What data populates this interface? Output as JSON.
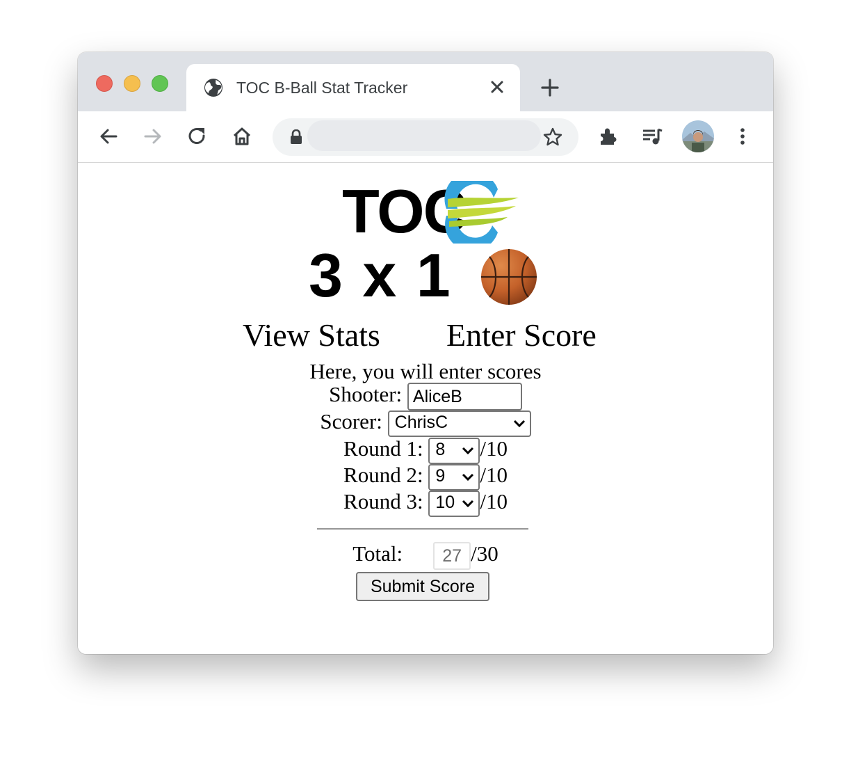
{
  "browser": {
    "tab_title": "TOC B-Ball Stat Tracker",
    "url": ""
  },
  "logo": {
    "line1": "TOC",
    "line2": "3 x 1"
  },
  "nav": {
    "view_stats": "View Stats",
    "enter_score": "Enter Score"
  },
  "form": {
    "intro": "Here, you will enter scores",
    "shooter_label": "Shooter:",
    "shooter_value": "AliceB",
    "scorer_label": "Scorer:",
    "scorer_value": "ChrisC",
    "rounds": [
      {
        "label": "Round 1:",
        "value": "8",
        "max": "/10"
      },
      {
        "label": "Round 2:",
        "value": "9",
        "max": "/10"
      },
      {
        "label": "Round 3:",
        "value": "10",
        "max": "/10"
      }
    ],
    "total_label": "Total:",
    "total_value": "27",
    "total_max": "/30",
    "submit_label": "Submit Score"
  },
  "colors": {
    "tabbar": "#dee1e6",
    "close_red": "#ee6a5f",
    "minimize_yellow": "#f5bf4f",
    "maximize_green": "#61c554",
    "logo_blue": "#35a3dc",
    "logo_green": "#b6d334",
    "ball_orange": "#c8662a"
  },
  "icons": [
    "globe-icon",
    "close-icon",
    "plus-icon",
    "back-icon",
    "forward-icon",
    "reload-icon",
    "home-icon",
    "lock-icon",
    "star-icon",
    "extensions-icon",
    "media-icon",
    "avatar",
    "more-icon",
    "basketball-icon",
    "chevron-down-icon"
  ]
}
